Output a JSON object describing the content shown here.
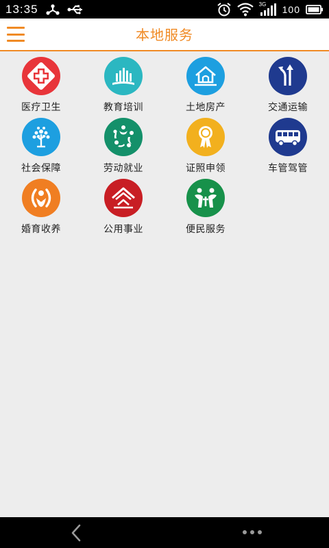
{
  "status_bar": {
    "time": "13:35",
    "network": "3G",
    "battery_text": "100",
    "icons": [
      "share-icon",
      "usb-icon",
      "alarm-icon",
      "wifi-icon",
      "signal-icon",
      "battery-icon"
    ]
  },
  "header": {
    "title": "本地服务",
    "menu_icon": "hamburger-menu-icon"
  },
  "colors": {
    "accent": "#f08a24",
    "red": "#e8353a",
    "teal": "#2bb7c1",
    "blue": "#1d9fe0",
    "navy": "#1f3a8f",
    "green": "#14906a",
    "yellow": "#f2b01e",
    "orange": "#f07e22",
    "crimson": "#c81e24",
    "darkgreen": "#17914a"
  },
  "services": [
    {
      "label": "医疗卫生",
      "icon": "medical-cross-icon",
      "color": "#e8353a"
    },
    {
      "label": "教育培训",
      "icon": "education-books-icon",
      "color": "#2bb7c1"
    },
    {
      "label": "土地房产",
      "icon": "house-icon",
      "color": "#1d9fe0"
    },
    {
      "label": "交通运输",
      "icon": "road-sign-icon",
      "color": "#1f3a8f"
    },
    {
      "label": "社会保障",
      "icon": "tree-icon",
      "color": "#1d9fe0"
    },
    {
      "label": "劳动就业",
      "icon": "people-circle-icon",
      "color": "#14906a"
    },
    {
      "label": "证照申领",
      "icon": "award-ribbon-icon",
      "color": "#f2b01e"
    },
    {
      "label": "车管驾管",
      "icon": "bus-icon",
      "color": "#1f3a8f"
    },
    {
      "label": "婚育收养",
      "icon": "family-icon",
      "color": "#f07e22"
    },
    {
      "label": "公用事业",
      "icon": "building-emblem-icon",
      "color": "#c81e24"
    },
    {
      "label": "便民服务",
      "icon": "community-icon",
      "color": "#17914a"
    }
  ],
  "nav": {
    "back_icon": "back-chevron-icon",
    "more_icon": "more-dots-icon"
  }
}
